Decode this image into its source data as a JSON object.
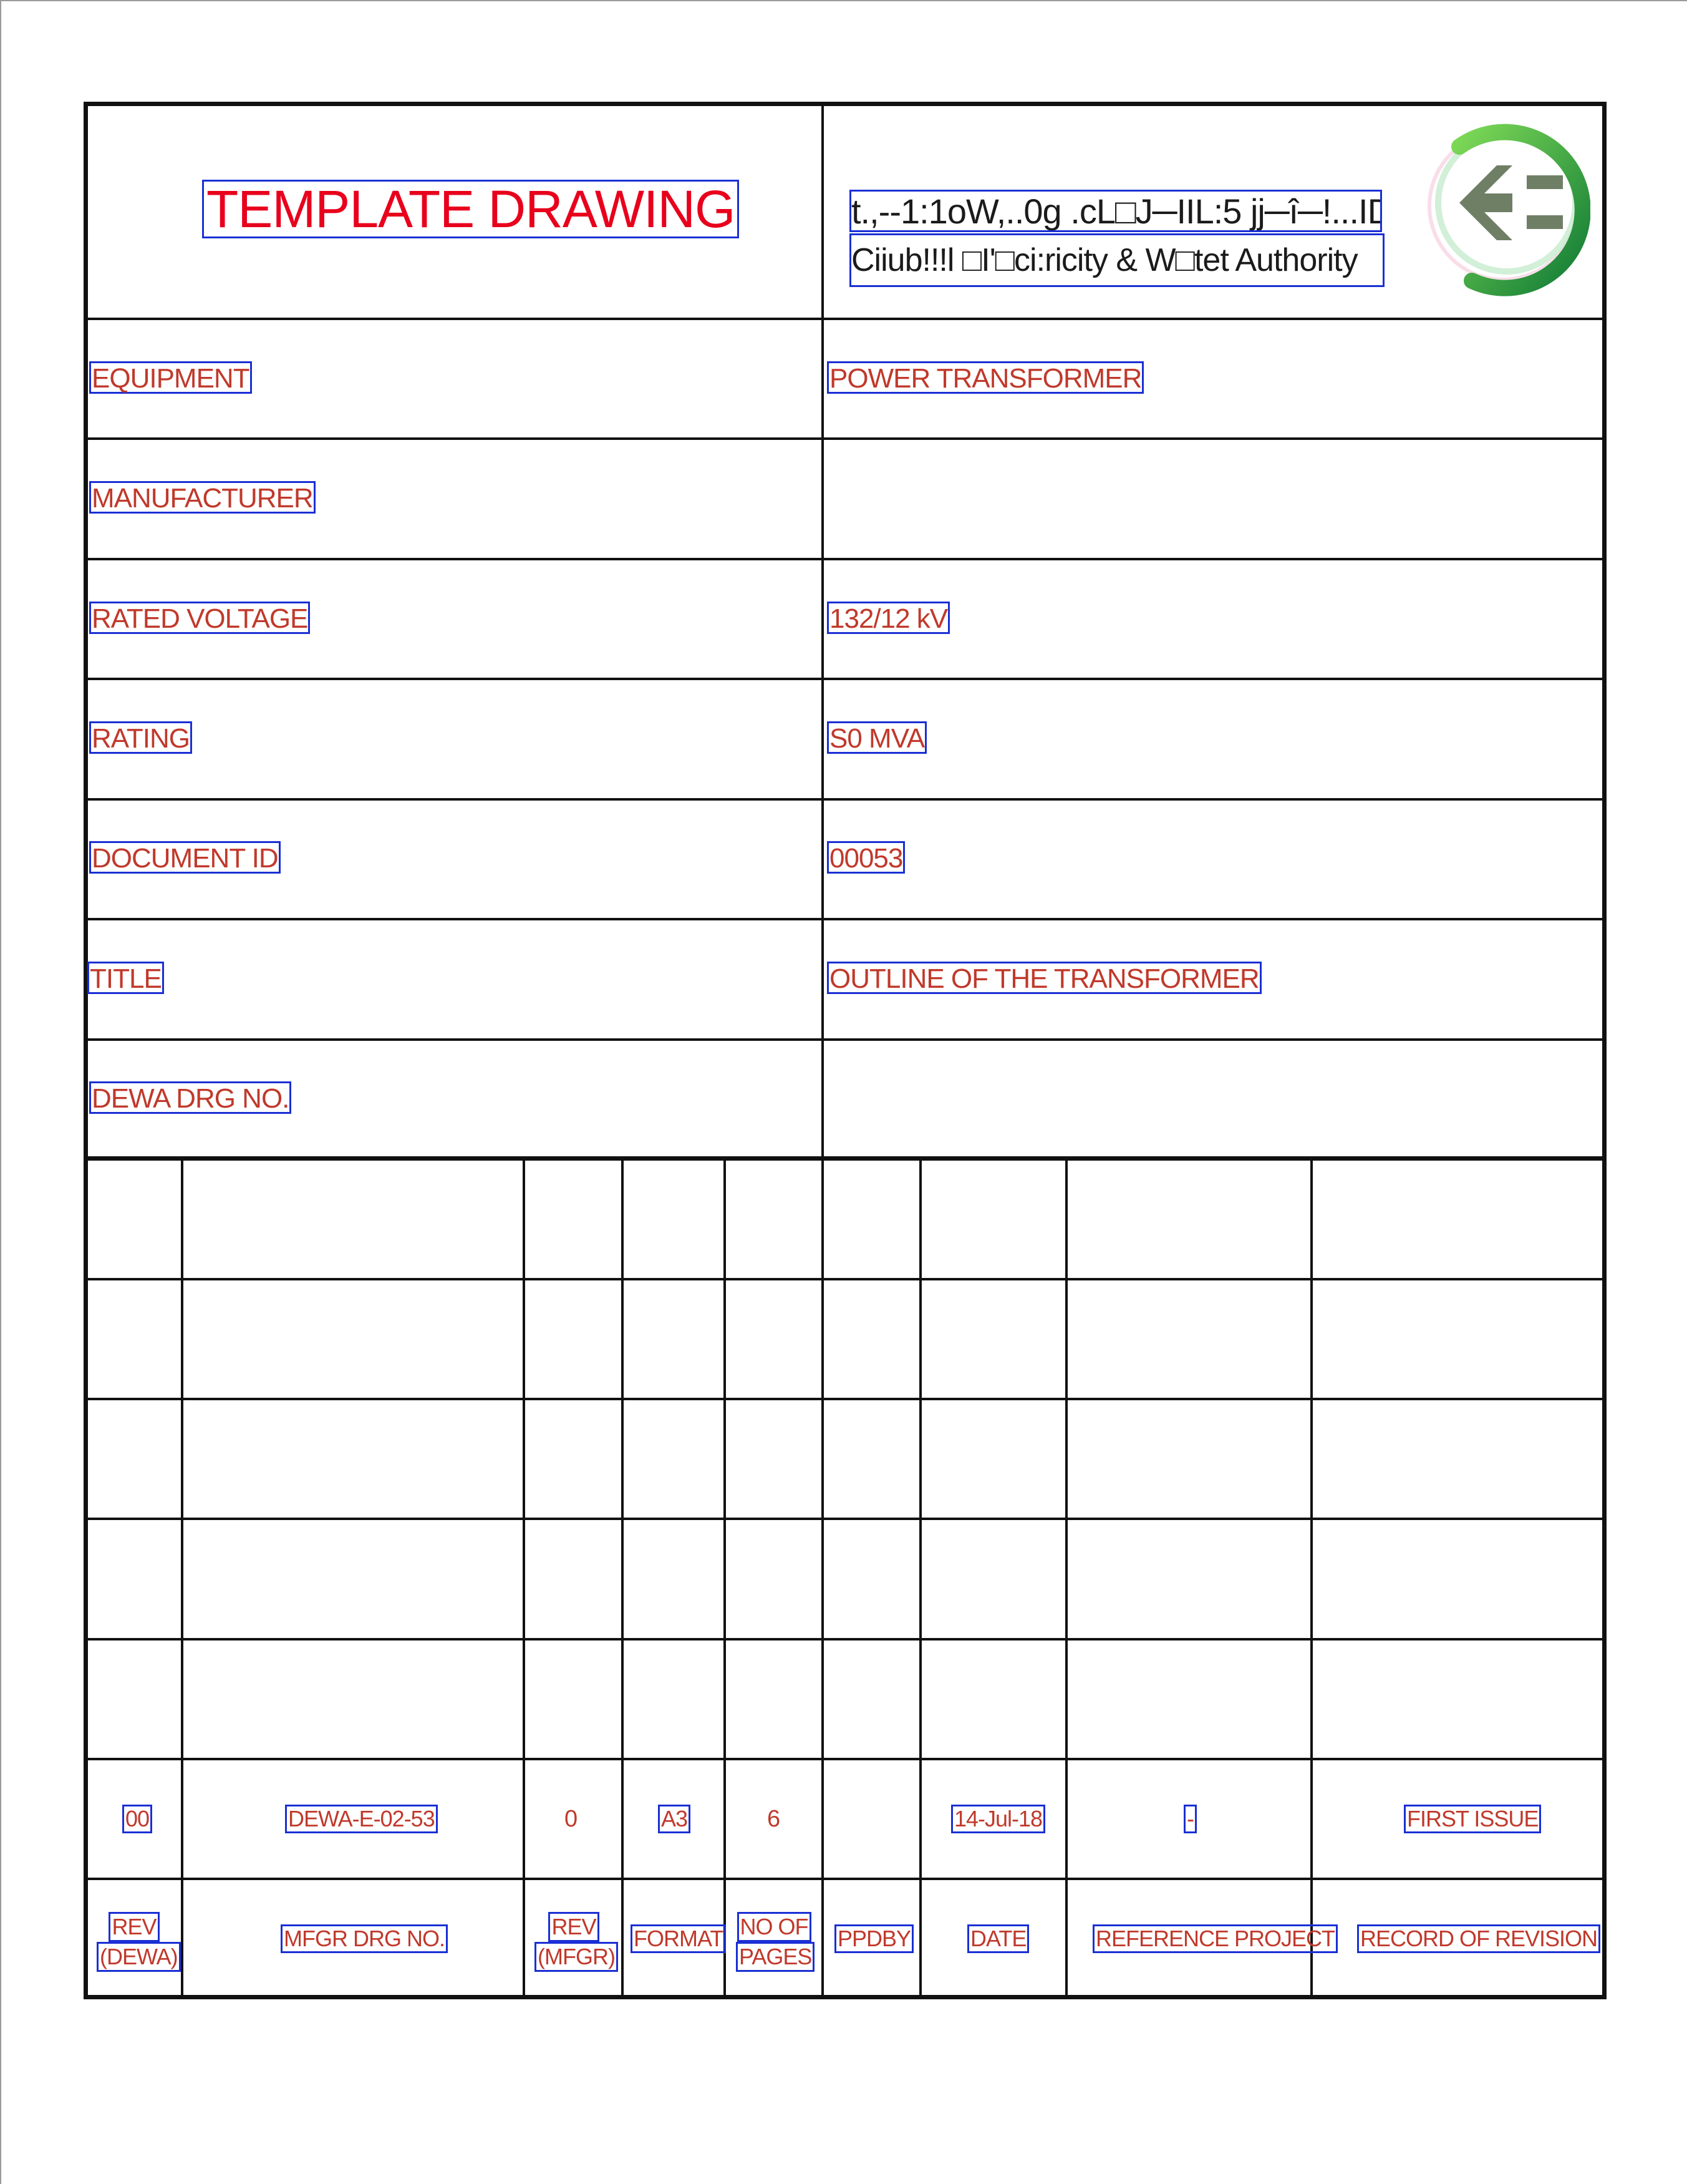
{
  "header": {
    "title": "TEMPLATE DRAWING",
    "org_arabic": "t.,--1:1oW,..0g .cL□J─IIL:5 jj─î─!...ID",
    "org_english": "Ciiub!!!l □I'□ci:ricity & W□tet Authority",
    "logo_icon": "dewa-logo-icon"
  },
  "fields": [
    {
      "label": "EQUIPMENT",
      "value": "POWER TRANSFORMER"
    },
    {
      "label": "MANUFACTURER",
      "value": ""
    },
    {
      "label": "RATED VOLTAGE",
      "value": "132/12 kV"
    },
    {
      "label": "RATING",
      "value": "S0 MVA"
    },
    {
      "label": "DOCUMENT ID",
      "value": "00053"
    },
    {
      "label": "TITLE",
      "value": "OUTLINE OF THE TRANSFORMER"
    },
    {
      "label": "DEWA DRG NO.",
      "value": ""
    }
  ],
  "revision_table": {
    "row": {
      "rev_dewa": "00",
      "mfgr_drg_no": "DEWA-E-02-53",
      "rev_mfgr": "0",
      "format": "A3",
      "no_of_pages": "6",
      "ppdby": "",
      "date": "14-Jul-18",
      "reference_project": "-",
      "record_of_revision": "FIRST ISSUE"
    },
    "headers": {
      "rev_dewa": [
        "REV",
        "(DEWA)"
      ],
      "mfgr_drg_no": "MFGR DRG NO.",
      "rev_mfgr": [
        "REV",
        "(MFGR)"
      ],
      "format": "FORMAT",
      "no_of_pages": [
        "NO OF",
        "PAGES"
      ],
      "ppdby": "PPDBY",
      "date": "DATE",
      "reference_project": "REFERENCE PROJECT",
      "record_of_revision": "RECORD OF REVISION"
    }
  },
  "colors": {
    "title": "#e8001c",
    "label": "#c0392b",
    "box": "#1a2fd4",
    "line": "#111111"
  }
}
